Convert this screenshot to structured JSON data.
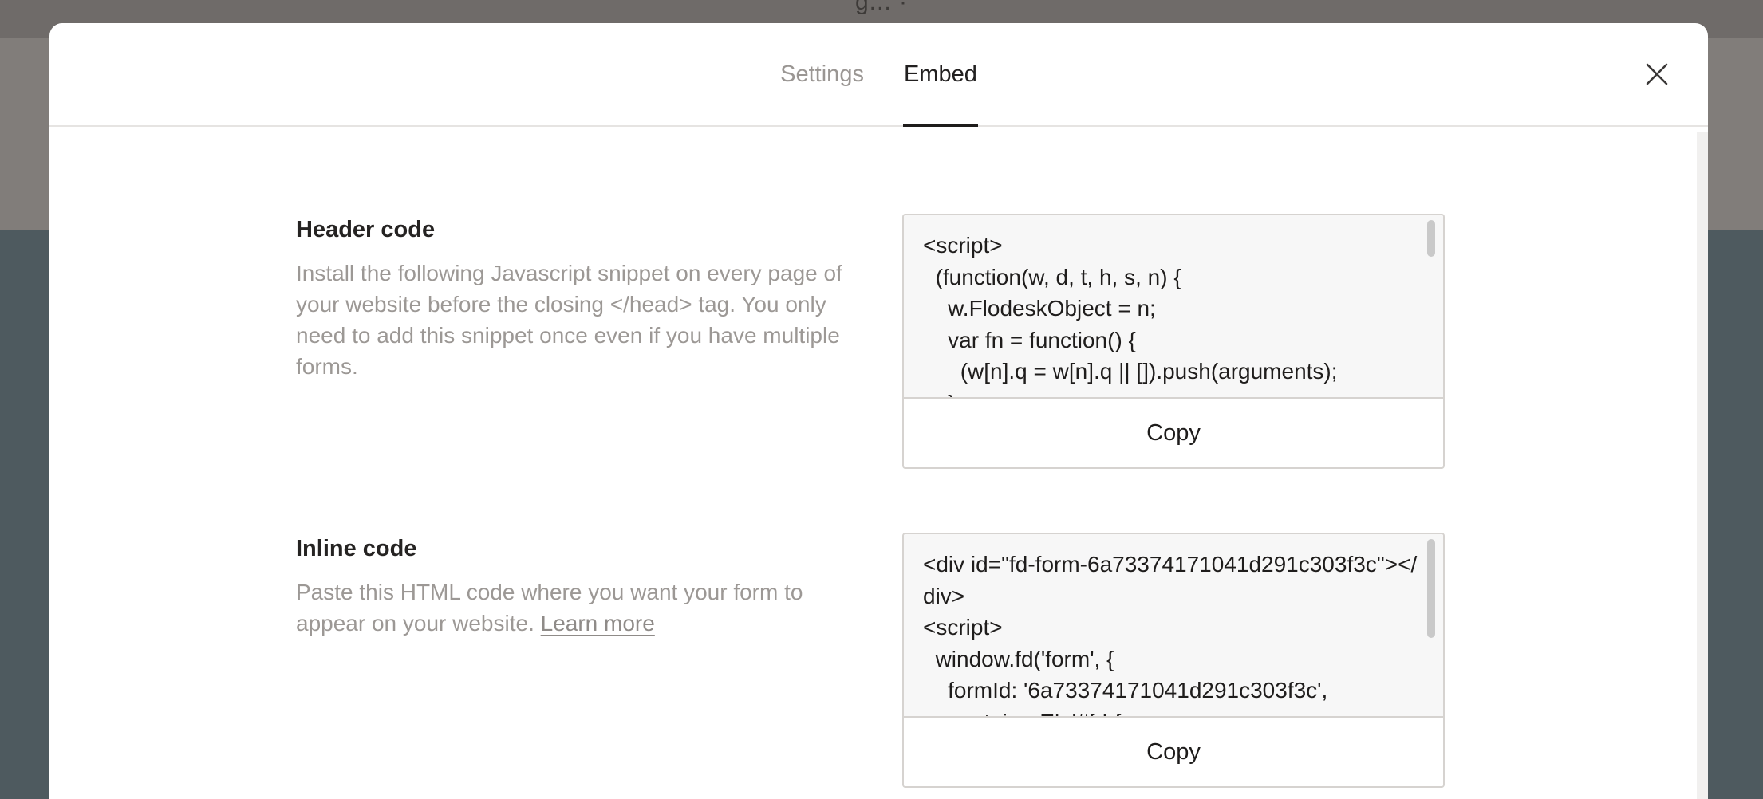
{
  "background": {
    "top_text": "g...  ·"
  },
  "modal": {
    "tabs": [
      {
        "label": "Settings",
        "active": false
      },
      {
        "label": "Embed",
        "active": true
      }
    ],
    "close_icon": "close-icon"
  },
  "header_code": {
    "title": "Header code",
    "description": "Install the following Javascript snippet on every page of your website before the closing </head> tag. You only need to add this snippet once even if you have multiple forms.",
    "code": "<script>\n  (function(w, d, t, h, s, n) {\n    w.FlodeskObject = n;\n    var fn = function() {\n      (w[n].q = w[n].q || []).push(arguments);\n    };",
    "copy_label": "Copy"
  },
  "inline_code": {
    "title": "Inline code",
    "description": "Paste this HTML code where you want your form to appear on your website.",
    "learn_more": "Learn more",
    "code": "<div id=\"fd-form-6a73374171041d291c303f3c\"></div>\n<script>\n  window.fd('form', {\n    formId: '6a73374171041d291c303f3c',\n    containerEl: '#fd-form-",
    "copy_label": "Copy"
  },
  "colors": {
    "overlay": "#7b7876",
    "modal_bg": "#ffffff",
    "code_bg": "#f7f7f7",
    "muted_text": "#9c9895",
    "active_tab_underline": "#1e1c1b"
  }
}
